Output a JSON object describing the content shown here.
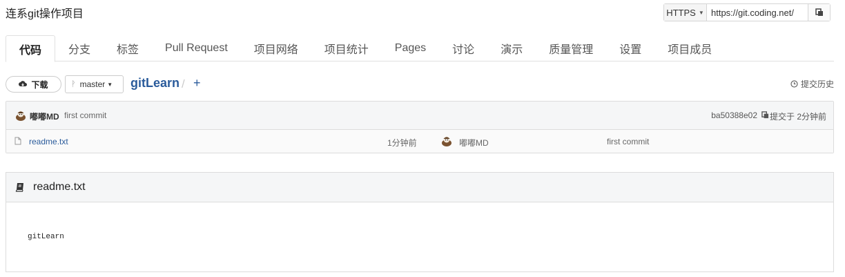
{
  "project": {
    "title": "连系git操作项目"
  },
  "clone": {
    "protocol": "HTTPS",
    "url": "https://git.coding.net/"
  },
  "tabs": [
    {
      "label": "代码",
      "active": true
    },
    {
      "label": "分支"
    },
    {
      "label": "标签"
    },
    {
      "label": "Pull Request"
    },
    {
      "label": "项目网络"
    },
    {
      "label": "项目统计"
    },
    {
      "label": "Pages"
    },
    {
      "label": "讨论"
    },
    {
      "label": "演示"
    },
    {
      "label": "质量管理"
    },
    {
      "label": "设置"
    },
    {
      "label": "项目成员"
    }
  ],
  "repo_bar": {
    "download_label": "下载",
    "branch": "master",
    "repo_name": "gitLearn",
    "path_separator": "/",
    "add_label": "+",
    "history_label": "提交历史"
  },
  "latest_commit": {
    "author": "嘟嘟MD",
    "message": "first commit",
    "hash": "ba50388e02",
    "time": "提交于 2分钟前"
  },
  "files": [
    {
      "name": "readme.txt",
      "time": "1分钟前",
      "author": "嘟嘟MD",
      "commit": "first commit"
    }
  ],
  "readme": {
    "title": "readme.txt",
    "content": "gitLearn"
  },
  "colors": {
    "link": "#2a5b9b",
    "header_bg": "#f5f6f7",
    "border": "#dcdcdc"
  }
}
